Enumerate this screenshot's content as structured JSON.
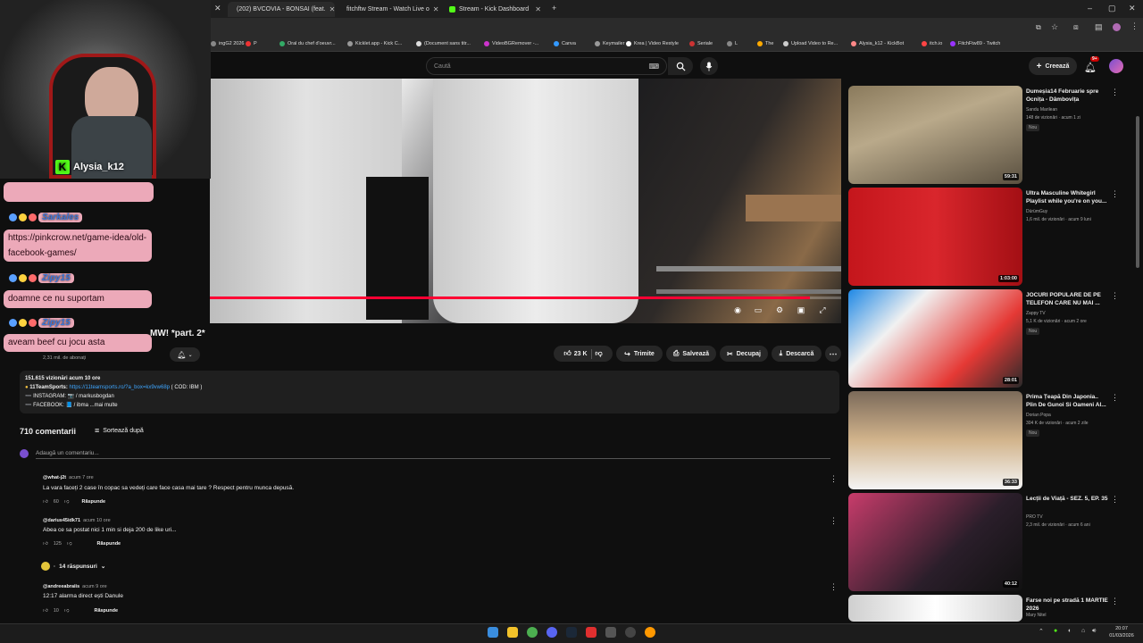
{
  "browser": {
    "tabs": [
      {
        "label": "(202) BVCOVIA - BONSAI (feat.",
        "color": "#ff0033"
      },
      {
        "label": "fitchftw Stream - Watch Live o",
        "color": "#53fc18"
      },
      {
        "label": "Stream - Kick Dashboard",
        "color": "#53fc18"
      }
    ],
    "bookmarks": [
      {
        "label": "ingG2 2026",
        "color": "#888"
      },
      {
        "label": "P",
        "color": "#e33"
      },
      {
        "label": "Oral du chef d'oeuvr...",
        "color": "#3a6"
      },
      {
        "label": "Kicklet.app - Kick C...",
        "color": "#999"
      },
      {
        "label": "(Document sans titr...",
        "color": "#ddd"
      },
      {
        "label": "VideoBGRemover -...",
        "color": "#c3c"
      },
      {
        "label": "Canva",
        "color": "#39f"
      },
      {
        "label": "Keymailer",
        "color": "#999"
      },
      {
        "label": "Krea | Video Restyle",
        "color": "#fff"
      },
      {
        "label": "Seriale",
        "color": "#c33"
      },
      {
        "label": "L",
        "color": "#888"
      },
      {
        "label": "The",
        "color": "#fa0"
      },
      {
        "label": "Upload Video to Re...",
        "color": "#ccc"
      },
      {
        "label": "Alysia_k12 - KickBot",
        "color": "#f88"
      },
      {
        "label": "itch.io",
        "color": "#f44"
      },
      {
        "label": "FitchFtw89 - Twitch",
        "color": "#93f"
      }
    ]
  },
  "yt_header": {
    "search_placeholder": "Caută",
    "create_label": "Creează",
    "notif_badge": "9+"
  },
  "stream_overlay": {
    "streamer_name": "Alysia_k12",
    "chat": [
      {
        "user": "",
        "message": ""
      },
      {
        "user": "Sarkales",
        "message": "https://pinkcrow.net/game-idea/old-facebook-games/"
      },
      {
        "user": "Zipy15",
        "message": "doamne ce nu suportam"
      },
      {
        "user": "Zipy15",
        "message": "aveam beef cu jocu asta"
      }
    ]
  },
  "video": {
    "title_fragment": "MW! *part. 2*",
    "subscribers": "2,31 mil. de abonați",
    "progress": 0.95,
    "likes": "23 K",
    "share_label": "Trimite",
    "save_label": "Salvează",
    "clip_label": "Decupaj",
    "download_label": "Descarcă",
    "description": {
      "views_line": "151.615 vizionări  acum 10 ore",
      "line1_prefix": "11TeamSports:",
      "line1_link": "https://11teamsports.ro/?a_box=kx9vw68p",
      "line1_suffix": "( COD: IBM )",
      "line2": "➖ INSTAGRAM: 📷 / markusbogdan",
      "line3": "➖ FACEBOOK: 📘 / ibma  ...mai multe"
    }
  },
  "comments": {
    "count_label": "710 comentarii",
    "sort_label": "Sortează după",
    "add_placeholder": "Adaugă un comentariu...",
    "items": [
      {
        "handle": "@what-j2t",
        "time": "acum 7 ore",
        "text": "La vara faceți 2 case în copac sa vedeți care face casa mai tare ? Respect pentru munca depusă.",
        "likes": "60",
        "reply": "Răspunde"
      },
      {
        "handle": "@darius45idk71",
        "time": "acum 10 ore",
        "text": "Abea ce sa postat nici 1 min si deja 200 de like uri...",
        "likes": "125",
        "reply": "Răspunde"
      },
      {
        "handle": "@andreeabraiis",
        "time": "acum 9 ore",
        "text": "12:17 alarma direct ești Danule",
        "likes": "10",
        "reply": "Răspunde"
      }
    ],
    "replies_label": "14 răspunsuri"
  },
  "sidebar": [
    {
      "title": "Dumeșia14 Februarie spre Ocnița - Dâmbovița",
      "channel": "Sandu Marilean",
      "meta": "148 de vizionări · acum 1 zi",
      "new": "Nou",
      "duration": "59:31"
    },
    {
      "title": "Ultra Masculine Whitegirl Playlist while you're on you...",
      "channel": "DürümGuy",
      "meta": "1,6 mil. de vizionări · acum 9 luni",
      "new": "",
      "duration": "1:03:00"
    },
    {
      "title": "JOCURI POPULARE DE PE TELEFON CARE NU MAI ...",
      "channel": "Zappy TV",
      "meta": "5,1 K de vizionări · acum 2 ore",
      "new": "Nou",
      "duration": "28:01"
    },
    {
      "title": "Prima Țeapă Din Japonia.. Plin De Gunoi Si Oameni Al...",
      "channel": "Dorian Popa",
      "meta": "304 K de vizionări · acum 2 zile",
      "new": "Nou",
      "duration": "36:33"
    },
    {
      "title": "Lecții de Viață - SEZ. 5, EP. 35",
      "channel": "PRO TV",
      "meta": "2,3 mil. de vizionări · acum 6 ani",
      "new": "",
      "duration": "40:12"
    },
    {
      "title": "Farse noi pe stradă 1 MARTIE  2026",
      "channel": "Mary Nitel",
      "meta": "",
      "new": "",
      "duration": ""
    }
  ],
  "taskbar": {
    "time": "20:07",
    "date": "01/03/2026"
  },
  "colors": {
    "accent": "#ff0033",
    "kick": "#53fc18",
    "chat_pill": "#ffb6c8"
  }
}
